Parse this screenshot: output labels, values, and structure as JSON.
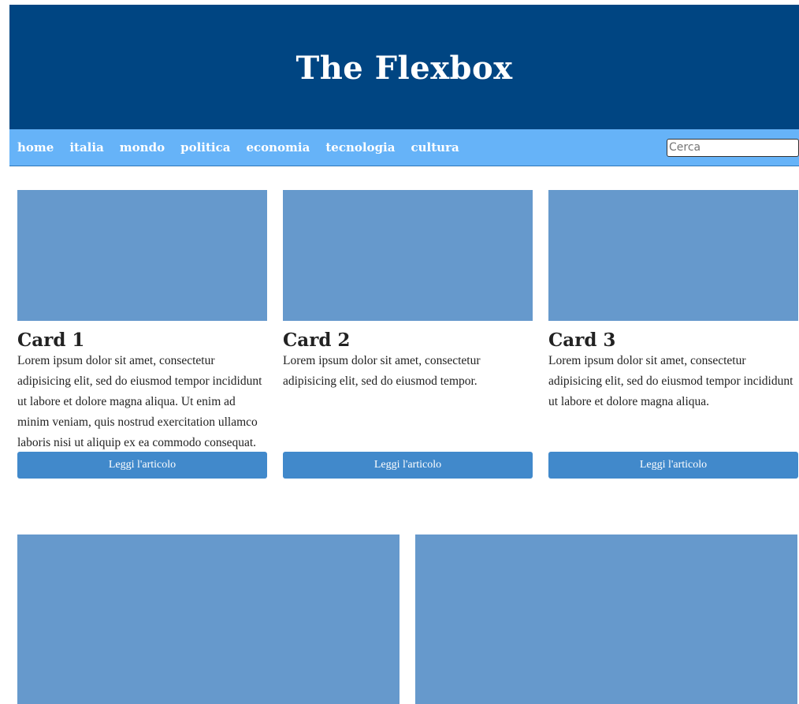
{
  "header": {
    "title": "The Flexbox"
  },
  "nav": {
    "items": [
      {
        "label": "home"
      },
      {
        "label": "italia"
      },
      {
        "label": "mondo"
      },
      {
        "label": "politica"
      },
      {
        "label": "economia"
      },
      {
        "label": "tecnologia"
      },
      {
        "label": "cultura"
      }
    ],
    "search_placeholder": "Cerca"
  },
  "cards": [
    {
      "title": "Card 1",
      "text": "Lorem ipsum dolor sit amet, consectetur adipisicing elit, sed do eiusmod tempor incididunt ut labore et dolore magna aliqua. Ut enim ad minim veniam, quis nostrud exercitation ullamco laboris nisi ut aliquip ex ea commodo consequat.",
      "button_label": "Leggi l'articolo"
    },
    {
      "title": "Card 2",
      "text": "Lorem ipsum dolor sit amet, consectetur adipisicing elit, sed do eiusmod tempor.",
      "button_label": "Leggi l'articolo"
    },
    {
      "title": "Card 3",
      "text": "Lorem ipsum dolor sit amet, consectetur adipisicing elit, sed do eiusmod tempor incididunt ut labore et dolore magna aliqua.",
      "button_label": "Leggi l'articolo"
    }
  ],
  "colors": {
    "header_bg": "#004582",
    "nav_bg": "#66b3f8",
    "image_placeholder": "#6699cc",
    "button_bg": "#4189cb"
  }
}
